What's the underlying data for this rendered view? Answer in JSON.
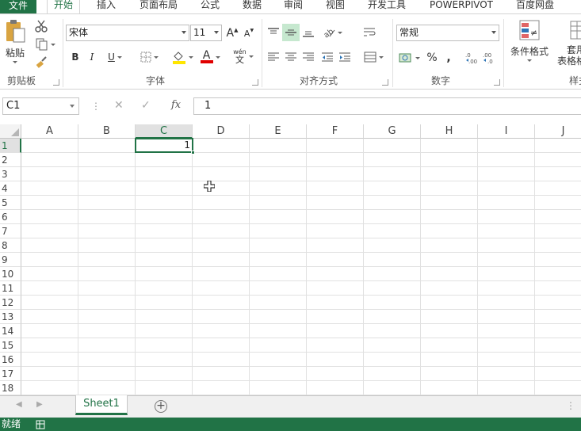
{
  "tabs": {
    "file": "文件",
    "home": "开始",
    "insert": "插入",
    "page_layout": "页面布局",
    "formulas": "公式",
    "data": "数据",
    "review": "审阅",
    "view": "视图",
    "developer": "开发工具",
    "powerpivot": "POWERPIVOT",
    "baidu": "百度网盘"
  },
  "ribbon": {
    "clipboard": {
      "paste_label": "粘贴",
      "group_label": "剪贴板"
    },
    "font": {
      "font_name": "宋体",
      "font_size": "11",
      "grow": "A",
      "shrink": "A",
      "bold": "B",
      "italic": "I",
      "underline": "U",
      "font_color_glyph": "A",
      "wen_top": "wén",
      "wen_bottom": "文",
      "group_label": "字体"
    },
    "alignment": {
      "group_label": "对齐方式"
    },
    "number": {
      "format": "常规",
      "percent": "%",
      "comma": ",",
      "group_label": "数字"
    },
    "styles": {
      "conditional_format": "条件格式",
      "table_format_line1": "套用",
      "table_format_line2": "表格格式",
      "group_label_partial": "样式"
    }
  },
  "formula_bar": {
    "name_box": "C1",
    "fx": "fx",
    "value": "1"
  },
  "grid": {
    "columns": [
      "A",
      "B",
      "C",
      "D",
      "E",
      "F",
      "G",
      "H",
      "I",
      "J"
    ],
    "rows": [
      "1",
      "2",
      "3",
      "4",
      "5",
      "6",
      "7",
      "8",
      "9",
      "10",
      "11",
      "12",
      "13",
      "14",
      "15",
      "16",
      "17",
      "18"
    ],
    "active_cell": {
      "ref": "C1",
      "value": "1"
    }
  },
  "sheets": {
    "tabs": [
      "Sheet1"
    ],
    "add_label": "+"
  },
  "status": {
    "ready": "就绪"
  },
  "colors": {
    "accent": "#217346"
  }
}
